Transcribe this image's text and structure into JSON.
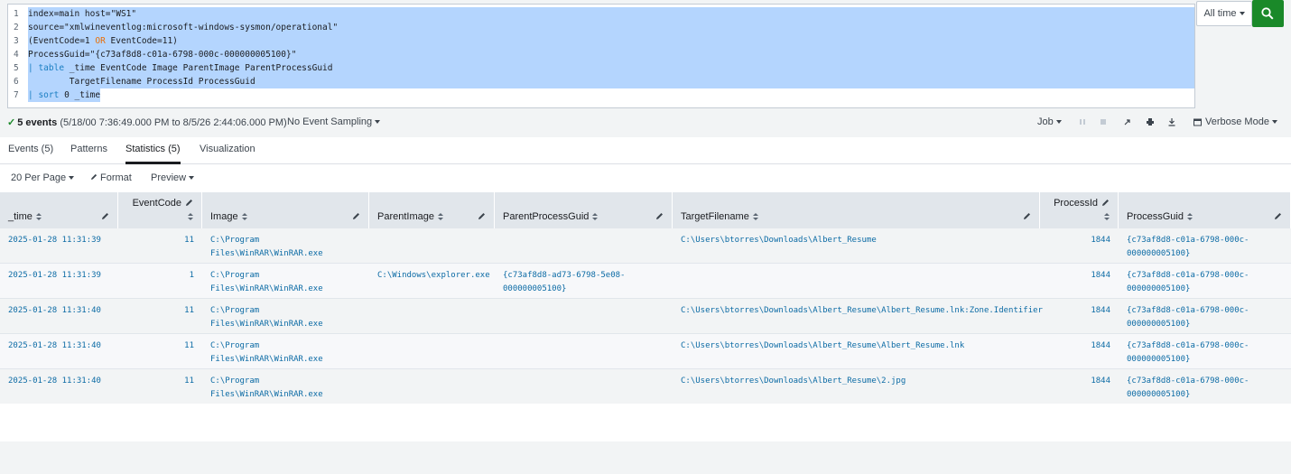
{
  "search": {
    "lines": [
      {
        "n": "1",
        "parts": [
          {
            "t": "index=main host=\"WS1\"",
            "c": ""
          }
        ]
      },
      {
        "n": "2",
        "parts": [
          {
            "t": "source=\"xmlwineventlog:microsoft-windows-sysmon/operational\"",
            "c": ""
          }
        ]
      },
      {
        "n": "3",
        "parts": [
          {
            "t": "(EventCode=1 ",
            "c": ""
          },
          {
            "t": "OR",
            "c": "op"
          },
          {
            "t": " EventCode=11)",
            "c": ""
          }
        ]
      },
      {
        "n": "4",
        "parts": [
          {
            "t": "ProcessGuid=\"{c73af8d8-c01a-6798-000c-000000005100}\"",
            "c": ""
          }
        ]
      },
      {
        "n": "5",
        "parts": [
          {
            "t": "| ",
            "c": "kw"
          },
          {
            "t": "table",
            "c": "kw"
          },
          {
            "t": " _time EventCode Image ParentImage ParentProcessGuid",
            "c": ""
          }
        ]
      },
      {
        "n": "6",
        "parts": [
          {
            "t": "        TargetFilename ProcessId ProcessGuid",
            "c": ""
          }
        ]
      },
      {
        "n": "7",
        "parts": [
          {
            "t": "| ",
            "c": "kw"
          },
          {
            "t": "sort",
            "c": "kw"
          },
          {
            "t": " 0 _time",
            "c": ""
          }
        ]
      }
    ],
    "time_label": "All time"
  },
  "status": {
    "events_count": "5 events",
    "range": "(5/18/00 7:36:49.000 PM to 8/5/26 2:44:06.000 PM)",
    "sampling": "No Event Sampling",
    "job": "Job",
    "mode": "Verbose Mode"
  },
  "tabs": [
    "Events (5)",
    "Patterns",
    "Statistics (5)",
    "Visualization"
  ],
  "toolbar": {
    "per_page": "20 Per Page",
    "format": "Format",
    "preview": "Preview"
  },
  "columns": [
    "_time",
    "EventCode",
    "Image",
    "ParentImage",
    "ParentProcessGuid",
    "TargetFilename",
    "ProcessId",
    "ProcessGuid"
  ],
  "rows": [
    {
      "time": "2025-01-28 11:31:39",
      "code": "11",
      "image": "C:\\Program\nFiles\\WinRAR\\WinRAR.exe",
      "parent": "",
      "pguid": "",
      "target": "C:\\Users\\btorres\\Downloads\\Albert_Resume",
      "pid": "1844",
      "guid": "{c73af8d8-c01a-6798-000c-\n000000005100}"
    },
    {
      "time": "2025-01-28 11:31:39",
      "code": "1",
      "image": "C:\\Program\nFiles\\WinRAR\\WinRAR.exe",
      "parent": "C:\\Windows\\explorer.exe",
      "pguid": "{c73af8d8-ad73-6798-5e08-\n000000005100}",
      "target": "",
      "pid": "1844",
      "guid": "{c73af8d8-c01a-6798-000c-\n000000005100}"
    },
    {
      "time": "2025-01-28 11:31:40",
      "code": "11",
      "image": "C:\\Program\nFiles\\WinRAR\\WinRAR.exe",
      "parent": "",
      "pguid": "",
      "target": "C:\\Users\\btorres\\Downloads\\Albert_Resume\\Albert_Resume.lnk:Zone.Identifier",
      "pid": "1844",
      "guid": "{c73af8d8-c01a-6798-000c-\n000000005100}"
    },
    {
      "time": "2025-01-28 11:31:40",
      "code": "11",
      "image": "C:\\Program\nFiles\\WinRAR\\WinRAR.exe",
      "parent": "",
      "pguid": "",
      "target": "C:\\Users\\btorres\\Downloads\\Albert_Resume\\Albert_Resume.lnk",
      "pid": "1844",
      "guid": "{c73af8d8-c01a-6798-000c-\n000000005100}"
    },
    {
      "time": "2025-01-28 11:31:40",
      "code": "11",
      "image": "C:\\Program\nFiles\\WinRAR\\WinRAR.exe",
      "parent": "",
      "pguid": "",
      "target": "C:\\Users\\btorres\\Downloads\\Albert_Resume\\2.jpg",
      "pid": "1844",
      "guid": "{c73af8d8-c01a-6798-000c-\n000000005100}"
    }
  ]
}
